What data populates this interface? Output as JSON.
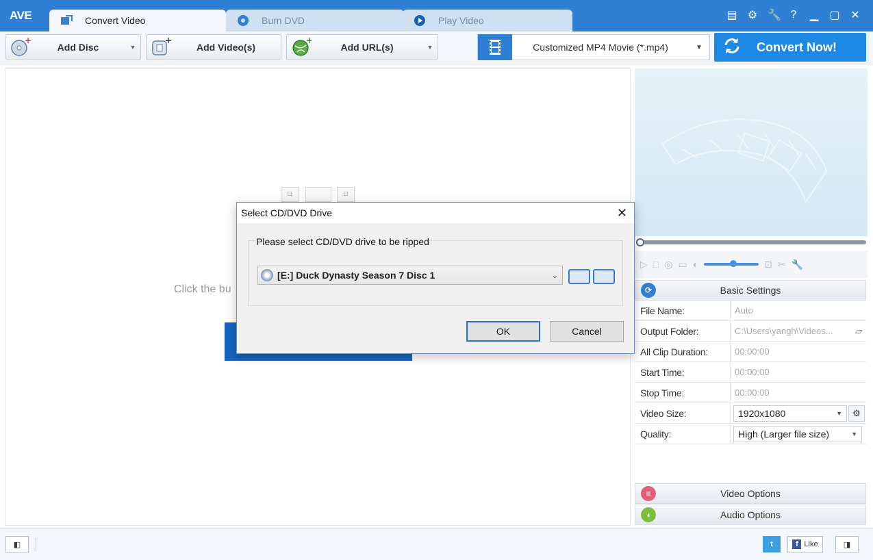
{
  "app": {
    "logo": "AVE"
  },
  "tabs": [
    {
      "label": "Convert Video",
      "icon": "convert-video-icon",
      "active": true
    },
    {
      "label": "Burn DVD",
      "icon": "burn-dvd-icon",
      "active": false
    },
    {
      "label": "Play Video",
      "icon": "play-video-icon",
      "active": false
    }
  ],
  "window_controls": [
    "menu-icon",
    "gear-icon",
    "key-icon",
    "help-icon",
    "minimize-icon",
    "maximize-icon",
    "close-icon"
  ],
  "window_controls_glyphs": {
    "help": "?"
  },
  "toolbar": {
    "add_disc": "Add Disc",
    "add_videos": "Add Video(s)",
    "add_url": "Add URL(s)",
    "format": "Customized MP4 Movie (*.mp4)",
    "convert_now": "Convert Now!"
  },
  "main": {
    "hint": "Click the bu"
  },
  "settings": {
    "header": "Basic Settings",
    "rows": [
      {
        "key": "File Name:",
        "value": "Auto"
      },
      {
        "key": "Output Folder:",
        "value": "C:\\Users\\yangh\\Videos..."
      },
      {
        "key": "All Clip Duration:",
        "value": "00:00:00"
      },
      {
        "key": "Start Time:",
        "value": "00:00:00"
      },
      {
        "key": "Stop Time:",
        "value": "00:00:00"
      },
      {
        "key": "Video Size:",
        "value": "1920x1080"
      },
      {
        "key": "Quality:",
        "value": "High (Larger file size)"
      }
    ],
    "video_options": "Video Options",
    "audio_options": "Audio Options"
  },
  "statusbar": {
    "like": "Like"
  },
  "dialog": {
    "title": "Select CD/DVD Drive",
    "prompt": "Please select CD/DVD drive to be ripped",
    "drive": "[E:] Duck Dynasty Season 7 Disc 1",
    "ok": "OK",
    "cancel": "Cancel"
  },
  "colors": {
    "titlebar": "#2f7fd4",
    "convert_button": "#1e88e5",
    "dialog_primary_border": "#2c6fd1"
  }
}
